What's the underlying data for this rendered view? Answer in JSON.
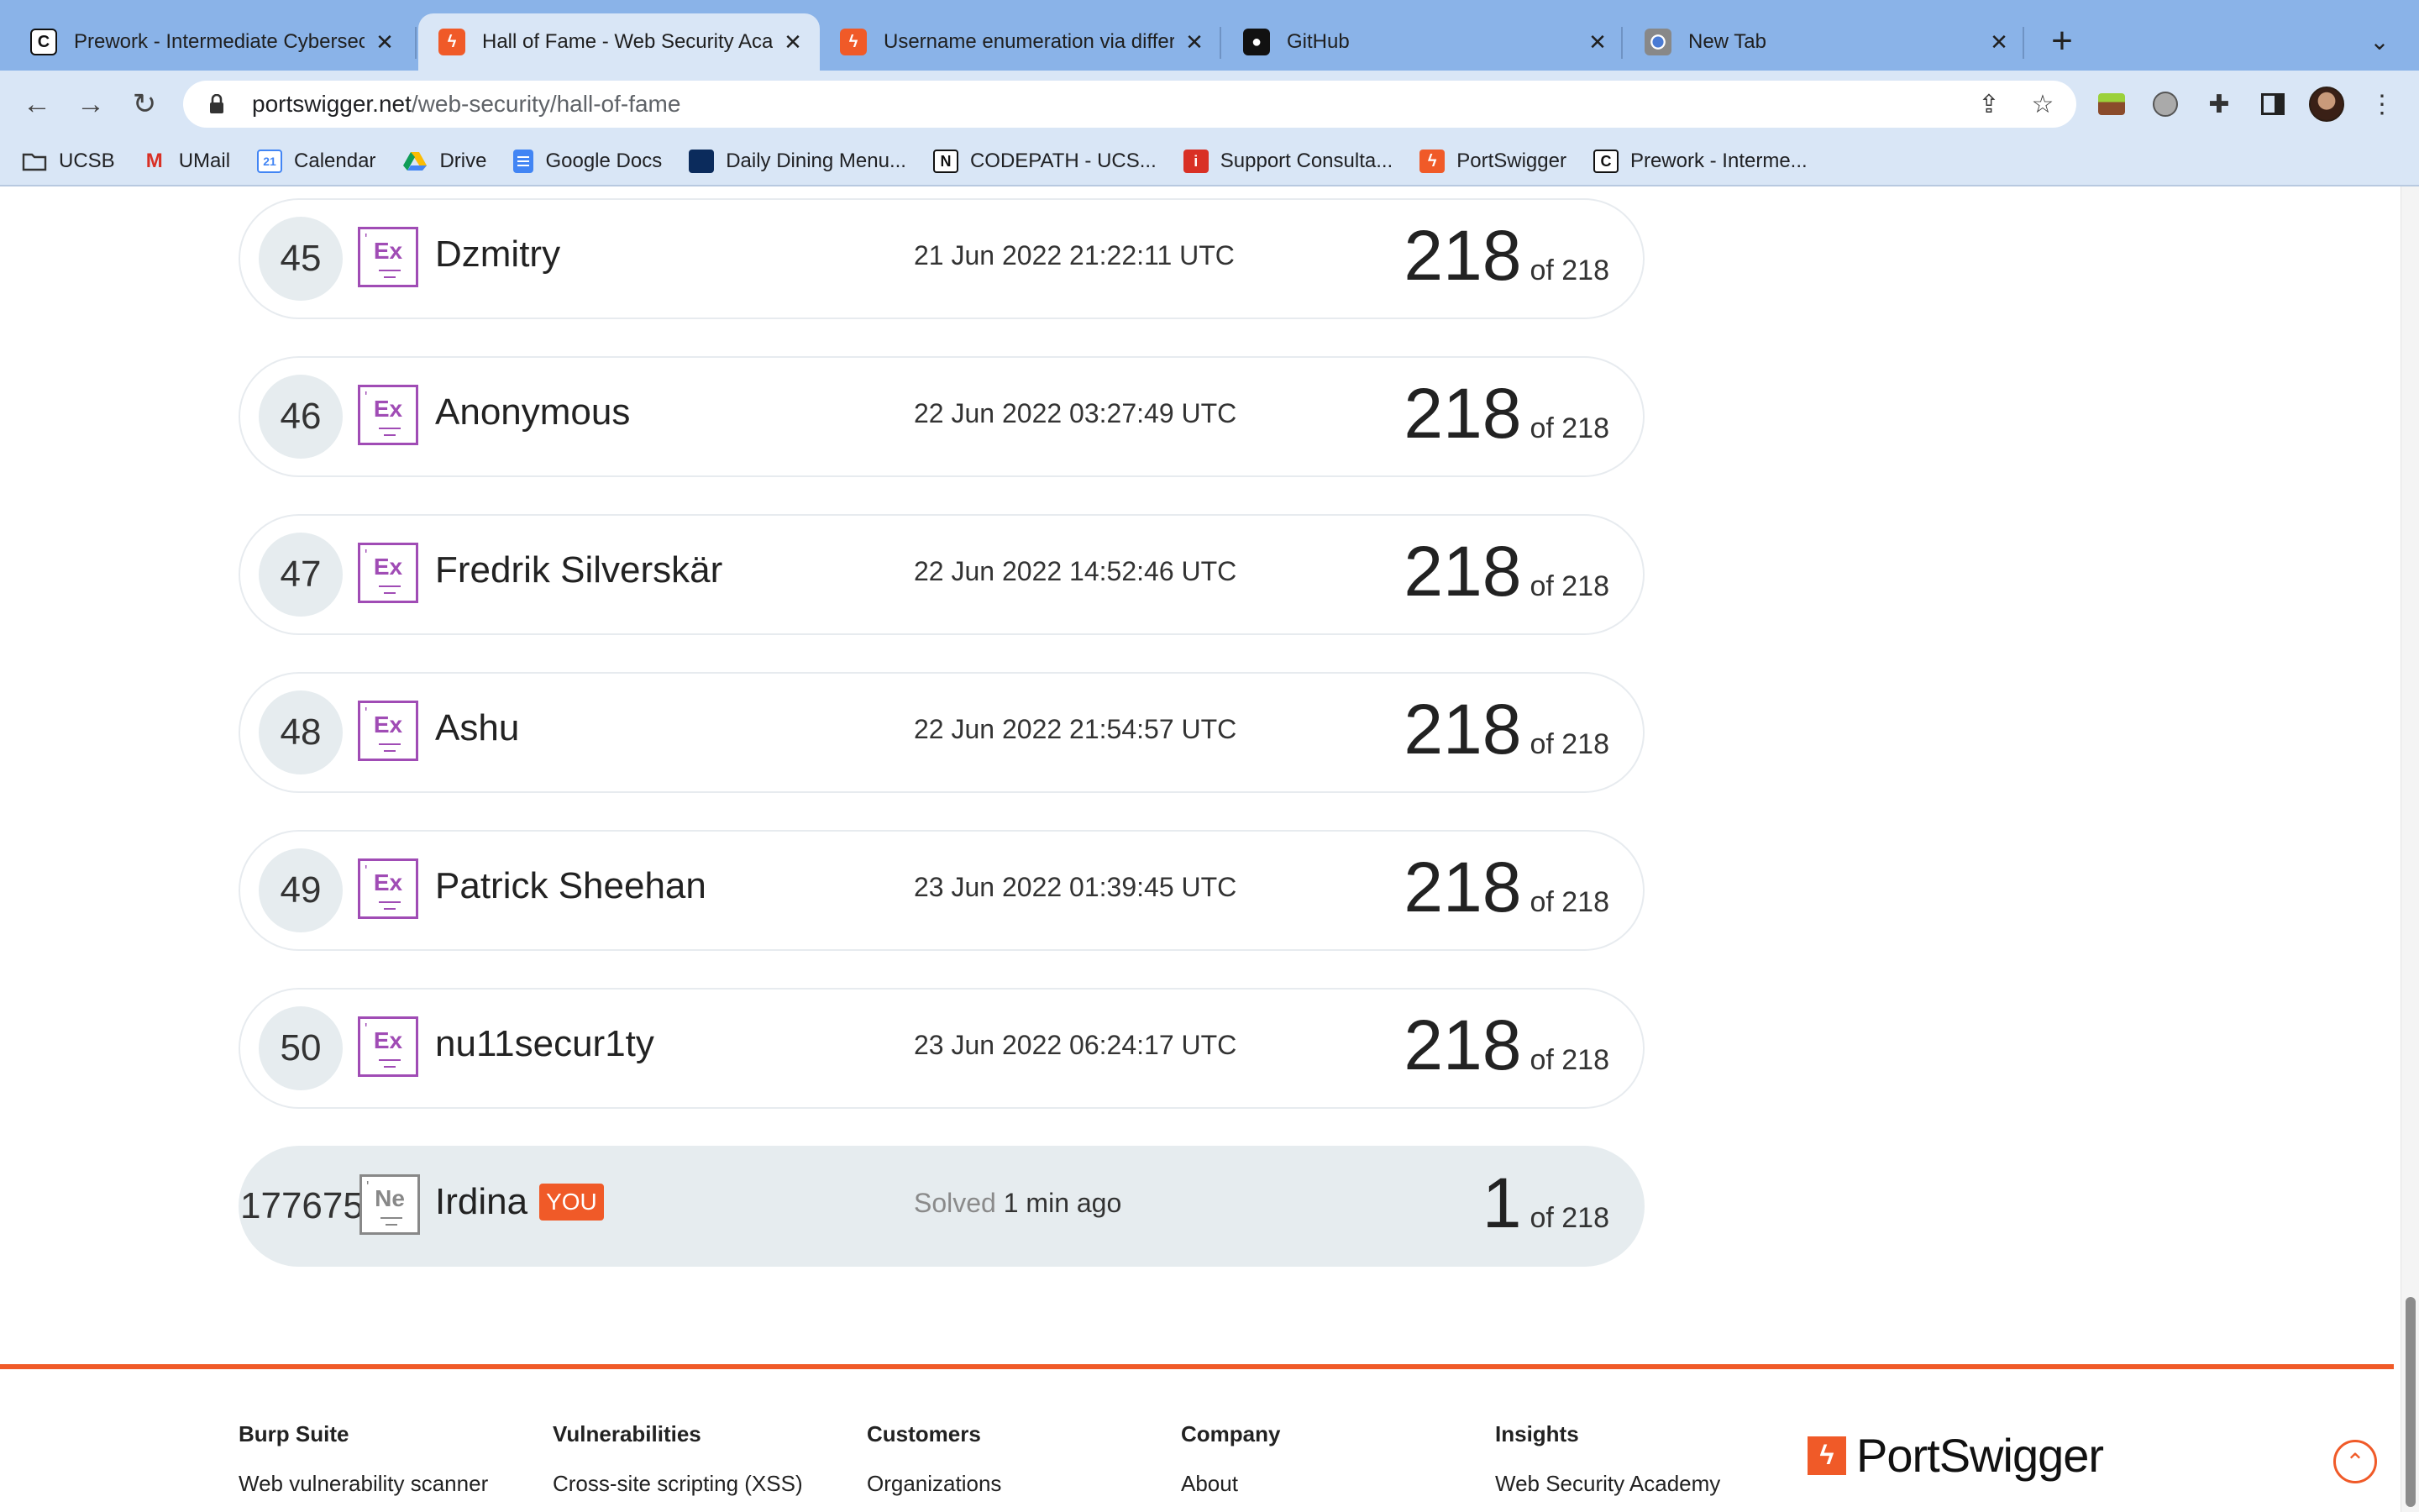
{
  "browser": {
    "tabs": [
      {
        "title": "Prework - Intermediate Cybersecurity",
        "favicon": "codepath-icon",
        "active": false
      },
      {
        "title": "Hall of Fame - Web Security Academy",
        "favicon": "portswigger-icon",
        "active": true
      },
      {
        "title": "Username enumeration via different responses",
        "favicon": "portswigger-icon",
        "active": false
      },
      {
        "title": "GitHub",
        "favicon": "github-icon",
        "active": false
      },
      {
        "title": "New Tab",
        "favicon": "chrome-icon",
        "active": false
      }
    ],
    "url_host": "portswigger.net",
    "url_path": "/web-security/hall-of-fame",
    "bookmarks": [
      {
        "label": "UCSB",
        "icon": "folder-icon"
      },
      {
        "label": "UMail",
        "icon": "gmail-icon"
      },
      {
        "label": "Calendar",
        "icon": "calendar-icon"
      },
      {
        "label": "Drive",
        "icon": "drive-icon"
      },
      {
        "label": "Google Docs",
        "icon": "docs-icon"
      },
      {
        "label": "Daily Dining Menu...",
        "icon": "ucsb-icon"
      },
      {
        "label": "CODEPATH - UCS...",
        "icon": "notion-icon"
      },
      {
        "label": "Support Consulta...",
        "icon": "support-icon"
      },
      {
        "label": "PortSwigger",
        "icon": "portswigger-icon"
      },
      {
        "label": "Prework - Interme...",
        "icon": "codepath-icon"
      }
    ],
    "calendar_day": "21",
    "icons": {
      "back": "arrow-left-icon",
      "forward": "arrow-right-icon",
      "reload": "reload-icon",
      "lock": "lock-icon",
      "share": "share-icon",
      "bookmark_star": "star-icon",
      "extensions": "puzzle-icon",
      "side_panel": "side-panel-icon",
      "menu": "kebab-menu-icon"
    }
  },
  "leaderboard": {
    "rows": [
      {
        "rank": "45",
        "badge": "Ex",
        "name": "Dzmitry",
        "date": "21 Jun 2022 21:22:11 UTC",
        "score": "218",
        "of": "of 218"
      },
      {
        "rank": "46",
        "badge": "Ex",
        "name": "Anonymous",
        "date": "22 Jun 2022 03:27:49 UTC",
        "score": "218",
        "of": "of 218"
      },
      {
        "rank": "47",
        "badge": "Ex",
        "name": "Fredrik Silverskär",
        "date": "22 Jun 2022 14:52:46 UTC",
        "score": "218",
        "of": "of 218"
      },
      {
        "rank": "48",
        "badge": "Ex",
        "name": "Ashu",
        "date": "22 Jun 2022 21:54:57 UTC",
        "score": "218",
        "of": "of 218"
      },
      {
        "rank": "49",
        "badge": "Ex",
        "name": "Patrick Sheehan",
        "date": "23 Jun 2022 01:39:45 UTC",
        "score": "218",
        "of": "of 218"
      },
      {
        "rank": "50",
        "badge": "Ex",
        "name": "nu11secur1ty",
        "date": "23 Jun 2022 06:24:17 UTC",
        "score": "218",
        "of": "of 218"
      }
    ],
    "you": {
      "rank": "177675",
      "badge": "Ne",
      "name": "Irdina",
      "tag": "YOU",
      "solved_label": "Solved",
      "solved_value": "1 min ago",
      "score": "1",
      "of": "of 218"
    }
  },
  "footer": {
    "columns": [
      {
        "heading": "Burp Suite",
        "link": "Web vulnerability scanner"
      },
      {
        "heading": "Vulnerabilities",
        "link": "Cross-site scripting (XSS)"
      },
      {
        "heading": "Customers",
        "link": "Organizations"
      },
      {
        "heading": "Company",
        "link": "About"
      },
      {
        "heading": "Insights",
        "link": "Web Security Academy"
      }
    ],
    "logo_text": "PortSwigger"
  },
  "colors": {
    "brand": "#f05a28",
    "expert_badge": "#a04cb5",
    "chrome_frame": "#8ab3e8",
    "chrome_toolbar": "#d9e6f6"
  }
}
